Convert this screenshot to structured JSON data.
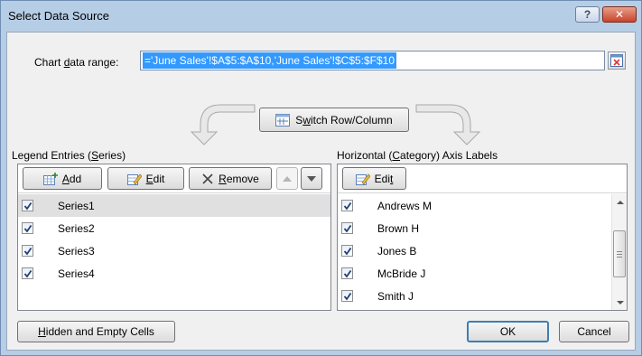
{
  "window": {
    "title": "Select Data Source",
    "help_label": "?",
    "close_label": "✕"
  },
  "range": {
    "label_pre": "Chart ",
    "label_accel": "d",
    "label_post": "ata range:",
    "value": "='June Sales'!$A$5:$A$10,'June Sales'!$C$5:$F$10"
  },
  "switch_button": {
    "pre": "S",
    "accel": "w",
    "post": "itch Row/Column"
  },
  "legend": {
    "label_pre": "Legend Entries (",
    "label_accel": "S",
    "label_post": "eries)",
    "add_accel": "A",
    "add_post": "dd",
    "edit_accel": "E",
    "edit_post": "dit",
    "remove_accel": "R",
    "remove_post": "emove",
    "items": [
      {
        "label": "Series1",
        "checked": true,
        "selected": true
      },
      {
        "label": "Series2",
        "checked": true,
        "selected": false
      },
      {
        "label": "Series3",
        "checked": true,
        "selected": false
      },
      {
        "label": "Series4",
        "checked": true,
        "selected": false
      }
    ]
  },
  "axis": {
    "label_pre": "Horizontal (",
    "label_accel": "C",
    "label_post": "ategory) Axis Labels",
    "edit_pre": "Edi",
    "edit_accel": "t",
    "items": [
      {
        "label": "Andrews M",
        "checked": true
      },
      {
        "label": "Brown H",
        "checked": true
      },
      {
        "label": "Jones B",
        "checked": true
      },
      {
        "label": "McBride J",
        "checked": true
      },
      {
        "label": "Smith J",
        "checked": true
      }
    ]
  },
  "footer": {
    "hidden_accel": "H",
    "hidden_post": "idden and Empty Cells",
    "ok_label": "OK",
    "cancel_label": "Cancel"
  },
  "colors": {
    "frame": "#b6cde6",
    "selection": "#3399ff",
    "close": "#c8432c"
  }
}
